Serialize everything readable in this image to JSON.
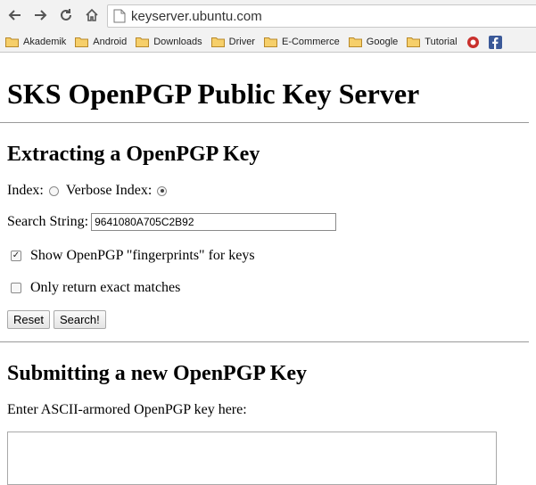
{
  "browser": {
    "url": "keyserver.ubuntu.com",
    "bookmarks": [
      {
        "label": "Akademik",
        "icon": "folder-icon"
      },
      {
        "label": "Android",
        "icon": "folder-icon"
      },
      {
        "label": "Downloads",
        "icon": "folder-icon"
      },
      {
        "label": "Driver",
        "icon": "folder-icon"
      },
      {
        "label": "E-Commerce",
        "icon": "folder-icon"
      },
      {
        "label": "Google",
        "icon": "folder-icon"
      },
      {
        "label": "Tutorial",
        "icon": "folder-icon"
      }
    ],
    "extra_bookmark_icons": [
      "app-favicon-icon",
      "facebook-icon"
    ]
  },
  "page": {
    "title": "SKS OpenPGP Public Key Server",
    "extract": {
      "heading": "Extracting a OpenPGP Key",
      "index_label": "Index:",
      "verbose_index_label": "Verbose Index:",
      "selected_index": "verbose",
      "search_label": "Search String:",
      "search_value": "9641080A705C2B92",
      "fingerprint_label": "Show OpenPGP \"fingerprints\" for keys",
      "fingerprint_checked": true,
      "exact_label": "Only return exact matches",
      "exact_checked": false,
      "reset_label": "Reset",
      "search_button_label": "Search!"
    },
    "submit": {
      "heading": "Submitting a new OpenPGP Key",
      "enter_label": "Enter ASCII-armored OpenPGP key here:",
      "key_text": ""
    }
  },
  "colors": {
    "chrome_bg": "#f2f2f2",
    "folder": "#e8b84a",
    "facebook": "#3b5998"
  }
}
